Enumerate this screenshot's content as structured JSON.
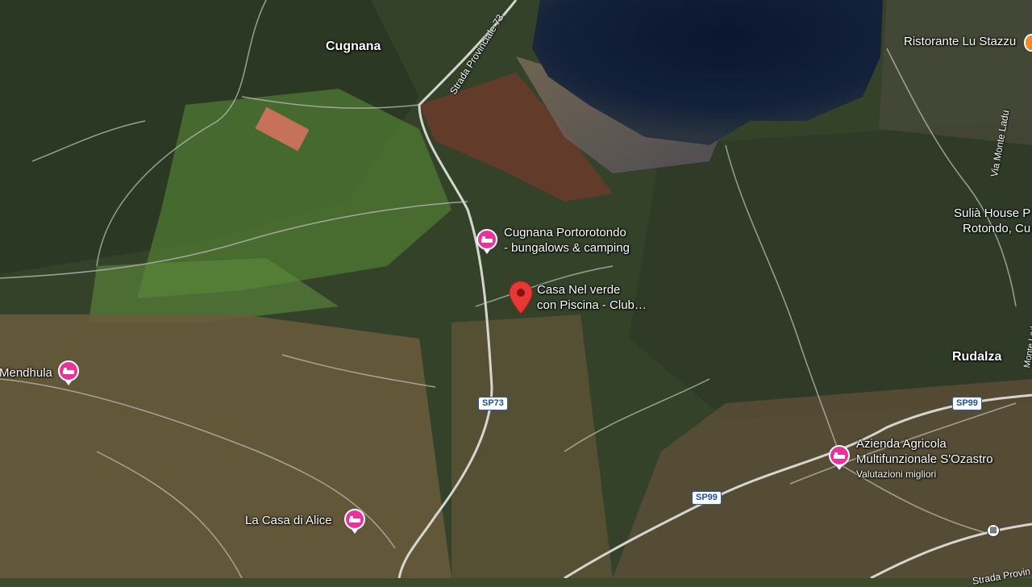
{
  "places": {
    "cugnana": "Cugnana",
    "rudalza": "Rudalza",
    "mendhula": "Mendhula"
  },
  "pois": {
    "ristorante": "Ristorante Lu Stazzu",
    "cugnana_camping_1": "Cugnana Portorotondo",
    "cugnana_camping_2": "- bungalows & camping",
    "casa_verde_1": "Casa Nel verde",
    "casa_verde_2": "con Piscina -  Club…",
    "sulia_1": "Sulià House P",
    "sulia_2": "Rotondo, Cu",
    "azienda_1": "Azienda Agricola",
    "azienda_2": "Multifunzionale S'Ozastro",
    "azienda_3": "Valutazioni migliori",
    "casa_alice": "La Casa di Alice"
  },
  "roads": {
    "sp73_shield": "SP73",
    "sp99_shield_a": "SP99",
    "sp99_shield_b": "SP99",
    "strada_prov_73": "Strada Provinciale 73",
    "via_monte_ladu": "Via Monte Ladu",
    "monte_ladu_short": "Monte Ladu",
    "strada_prov_bottom": "Strada Provin"
  },
  "icons": {
    "lodging_pin": "bed-icon",
    "selected_pin": "map-marker-icon",
    "transit": "bus-icon"
  },
  "colors": {
    "lodging_pin": "#e8339a",
    "selected_pin": "#e53935",
    "shield_text": "#1a4fa8",
    "sea": "#0f1c33",
    "land": "#3d4a2c"
  }
}
